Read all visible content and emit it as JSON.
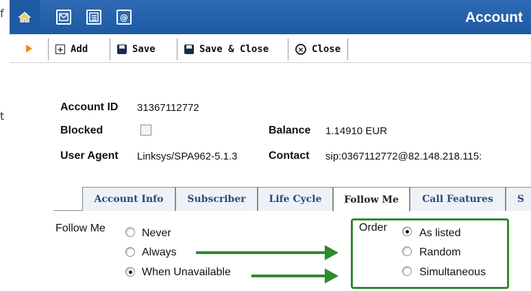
{
  "page_cut_text": {
    "line1": "f",
    "line2": "t"
  },
  "topbar": {
    "title": "Account",
    "icons": [
      "home-icon",
      "mail-icon",
      "list-icon",
      "at-icon"
    ]
  },
  "toolbar": {
    "add_label": "Add",
    "save_label": "Save",
    "save_close_label": "Save & Close",
    "close_label": "Close"
  },
  "account": {
    "id_label": "Account ID",
    "id_value": "31367112772",
    "blocked_label": "Blocked",
    "blocked_checked": false,
    "balance_label": "Balance",
    "balance_value": "1.14910 EUR",
    "user_agent_label": "User Agent",
    "user_agent_value": "Linksys/SPA962-5.1.3",
    "contact_label": "Contact",
    "contact_value": "sip:0367112772@82.148.218.115:"
  },
  "tabs": [
    {
      "label": "Account Info",
      "active": false
    },
    {
      "label": "Subscriber",
      "active": false
    },
    {
      "label": "Life Cycle",
      "active": false
    },
    {
      "label": "Follow Me",
      "active": true
    },
    {
      "label": "Call Features",
      "active": false
    },
    {
      "label": "S",
      "active": false
    }
  ],
  "follow_me": {
    "label": "Follow Me",
    "options": [
      {
        "label": "Never",
        "selected": false
      },
      {
        "label": "Always",
        "selected": false
      },
      {
        "label": "When Unavailable",
        "selected": true
      }
    ]
  },
  "order": {
    "label": "Order",
    "options": [
      {
        "label": "As listed",
        "selected": true
      },
      {
        "label": "Random",
        "selected": false
      },
      {
        "label": "Simultaneous",
        "selected": false
      }
    ]
  },
  "colors": {
    "topbar_blue": "#2f6bb4",
    "highlight_green": "#2d8a2d",
    "tab_text_blue": "#2a4a7a",
    "toolbar_arrow_orange": "#f08a1c"
  }
}
